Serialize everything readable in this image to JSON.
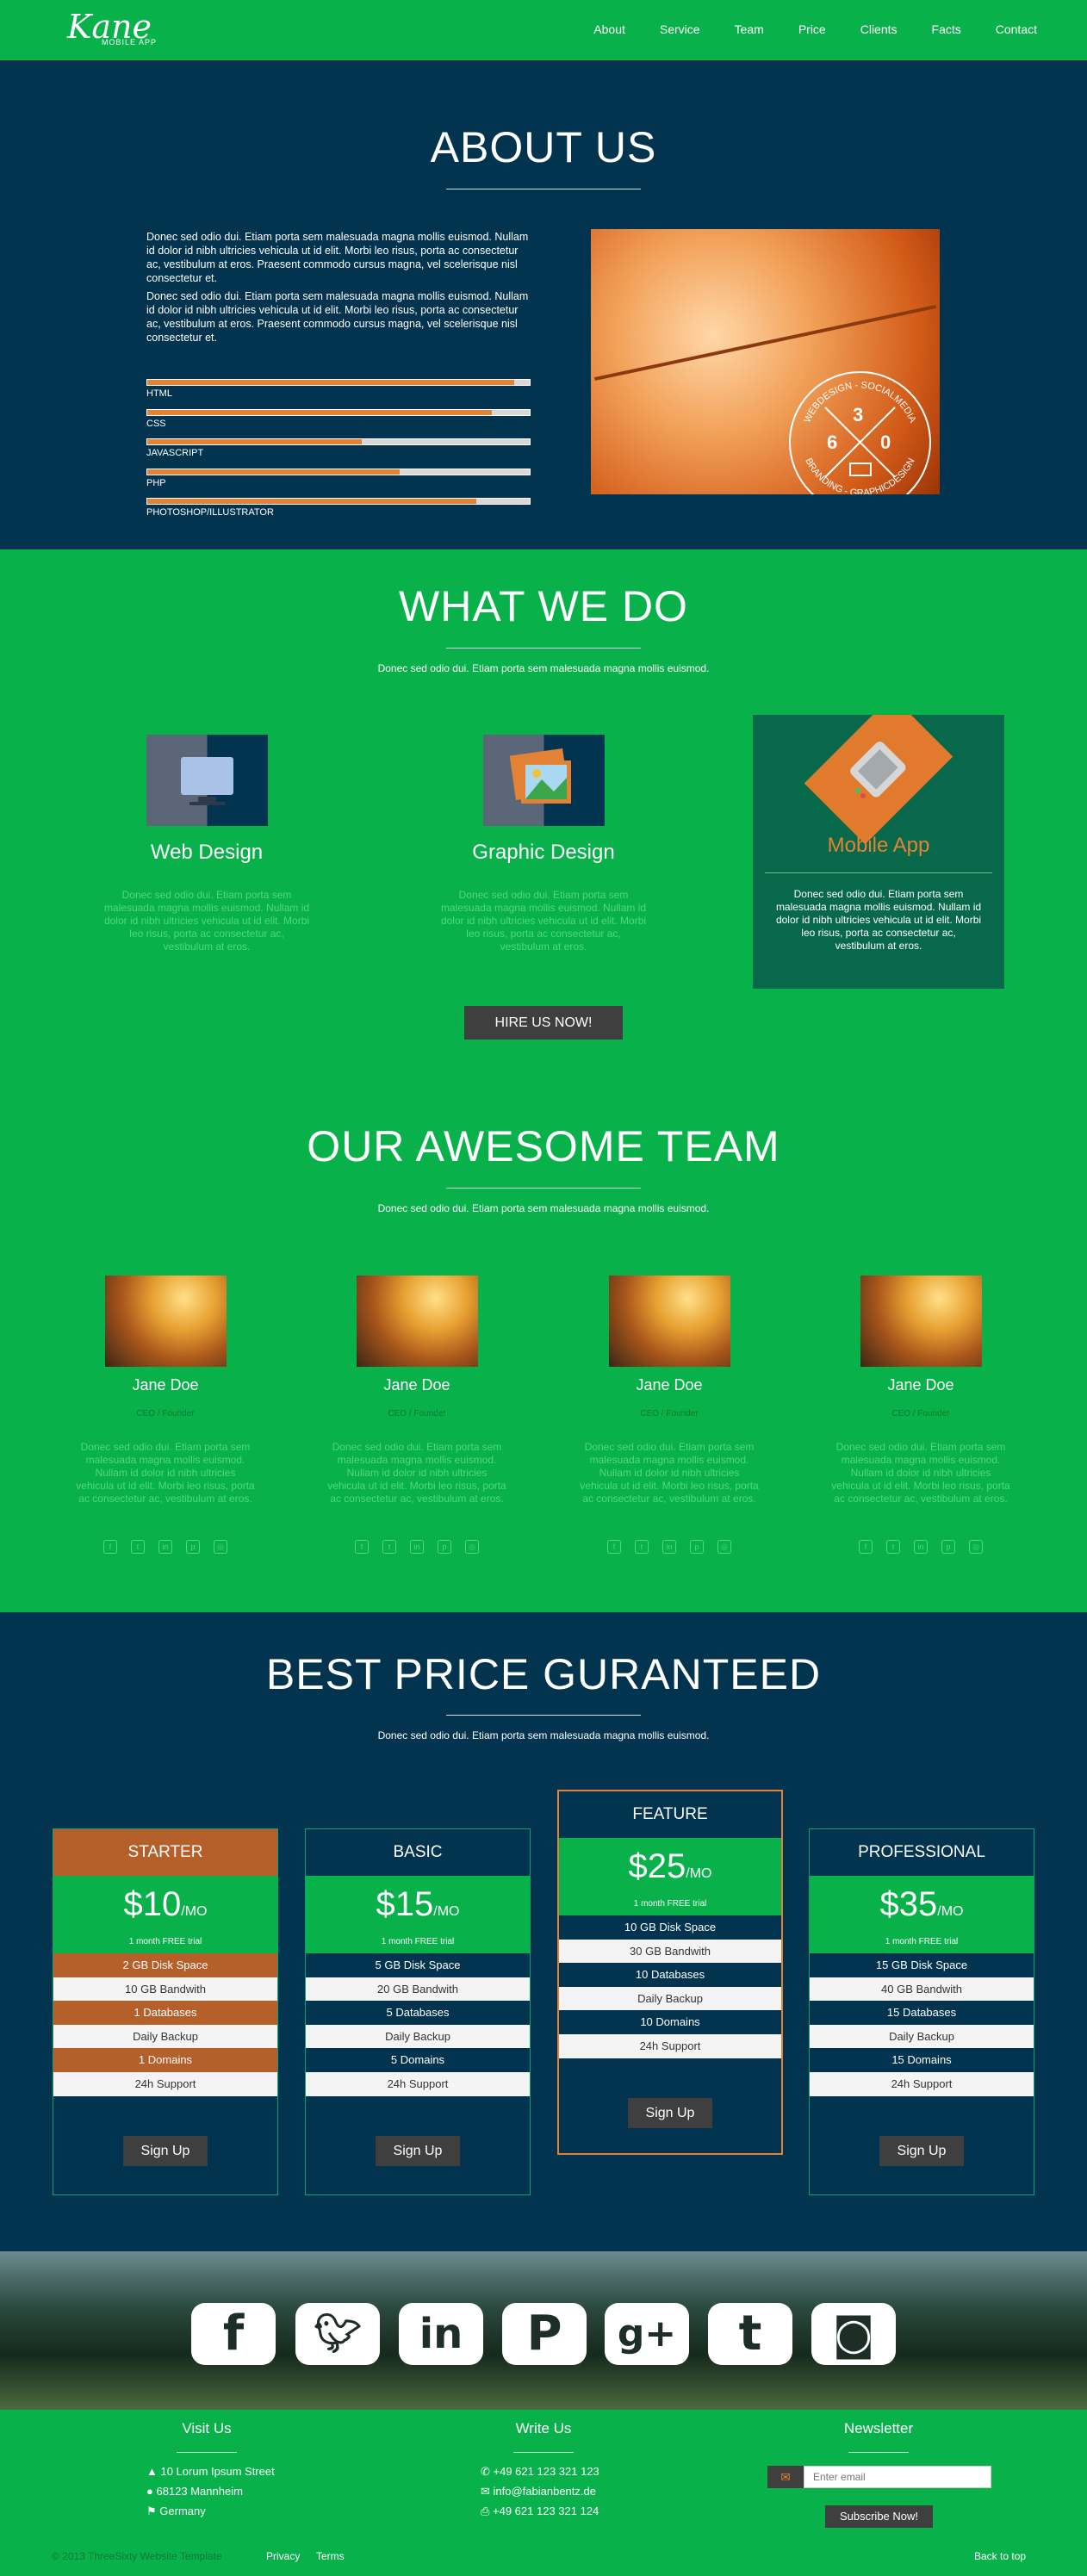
{
  "nav": {
    "logo": "Kane",
    "logo_sub": "MOBILE APP",
    "items": [
      "About",
      "Service",
      "Team",
      "Price",
      "Clients",
      "Facts",
      "Contact"
    ]
  },
  "about": {
    "title": "ABOUT US",
    "paragraphs": [
      "Donec sed odio dui. Etiam porta sem malesuada magna mollis euismod. Nullam id dolor id nibh ultricies vehicula ut id elit. Morbi leo risus, porta ac consectetur ac, vestibulum at eros. Praesent commodo cursus magna, vel scelerisque nisl consectetur et.",
      "Donec sed odio dui. Etiam porta sem malesuada magna mollis euismod. Nullam id dolor id nibh ultricies vehicula ut id elit. Morbi leo risus, porta ac consectetur ac, vestibulum at eros. Praesent commodo cursus magna, vel scelerisque nisl consectetur et."
    ],
    "skills": [
      {
        "label": "HTML",
        "level": 0.96
      },
      {
        "label": "CSS",
        "level": 0.9
      },
      {
        "label": "JAVASCRIPT",
        "level": 0.56
      },
      {
        "label": "PHP",
        "level": 0.66
      },
      {
        "label": "PHOTOSHOP/ILLUSTRATOR",
        "level": 0.86
      }
    ],
    "badge": {
      "arc_top": "WEBDESIGN - SOCIALMEDIA",
      "arc_bottom": "BRANDING - GRAPHICDESIGN",
      "n1": "3",
      "n2": "6",
      "n3": "0"
    }
  },
  "services": {
    "title": "WHAT WE DO",
    "subtitle": "Donec sed odio dui. Etiam porta sem malesuada magna mollis euismod.",
    "items": [
      {
        "title": "Web Design",
        "text": "Donec sed odio dui. Etiam porta sem malesuada magna mollis euismod. Nullam id dolor id nibh ultricies vehicula ut id elit. Morbi leo risus, porta ac consectetur ac, vestibulum at eros."
      },
      {
        "title": "Graphic Design",
        "text": "Donec sed odio dui. Etiam porta sem malesuada magna mollis euismod. Nullam id dolor id nibh ultricies vehicula ut id elit. Morbi leo risus, porta ac consectetur ac, vestibulum at eros."
      },
      {
        "title": "Mobile App",
        "text": "Donec sed odio dui. Etiam porta sem malesuada magna mollis euismod. Nullam id dolor id nibh ultricies vehicula ut id elit. Morbi leo risus, porta ac consectetur ac, vestibulum at eros."
      }
    ],
    "cta": "HIRE US NOW!"
  },
  "team": {
    "title": "OUR AWESOME TEAM",
    "subtitle": "Donec sed odio dui. Etiam porta sem malesuada magna mollis euismod.",
    "members": [
      {
        "name": "Jane Doe",
        "role": "CEO / Founder",
        "text": "Donec sed odio dui. Etiam porta sem malesuada magna mollis euismod. Nullam id dolor id nibh ultricies vehicula ut id elit. Morbi leo risus, porta ac consectetur ac, vestibulum at eros."
      },
      {
        "name": "Jane Doe",
        "role": "CEO / Founder",
        "text": "Donec sed odio dui. Etiam porta sem malesuada magna mollis euismod. Nullam id dolor id nibh ultricies vehicula ut id elit. Morbi leo risus, porta ac consectetur ac, vestibulum at eros."
      },
      {
        "name": "Jane Doe",
        "role": "CEO / Founder",
        "text": "Donec sed odio dui. Etiam porta sem malesuada magna mollis euismod. Nullam id dolor id nibh ultricies vehicula ut id elit. Morbi leo risus, porta ac consectetur ac, vestibulum at eros."
      },
      {
        "name": "Jane Doe",
        "role": "CEO / Founder",
        "text": "Donec sed odio dui. Etiam porta sem malesuada magna mollis euismod. Nullam id dolor id nibh ultricies vehicula ut id elit. Morbi leo risus, porta ac consectetur ac, vestibulum at eros."
      }
    ],
    "social_icons": [
      "facebook-icon",
      "twitter-icon",
      "linkedin-icon",
      "pinterest-icon",
      "instagram-icon"
    ]
  },
  "pricing": {
    "title": "BEST PRICE GURANTEED",
    "subtitle": "Donec sed odio dui. Etiam porta sem malesuada magna mollis euismod.",
    "plans": [
      {
        "name": "STARTER",
        "price": "$10",
        "per": "/MO",
        "note": "1 month FREE trial",
        "features": [
          "2 GB Disk Space",
          "10 GB Bandwith",
          "1 Databases",
          "Daily Backup",
          "1 Domains",
          "24h Support"
        ],
        "button": "Sign Up"
      },
      {
        "name": "BASIC",
        "price": "$15",
        "per": "/MO",
        "note": "1 month FREE trial",
        "features": [
          "5 GB Disk Space",
          "20 GB Bandwith",
          "5 Databases",
          "Daily Backup",
          "5 Domains",
          "24h Support"
        ],
        "button": "Sign Up"
      },
      {
        "name": "FEATURE",
        "price": "$25",
        "per": "/MO",
        "note": "1 month FREE trial",
        "features": [
          "10 GB Disk Space",
          "30 GB Bandwith",
          "10 Databases",
          "Daily Backup",
          "10 Domains",
          "24h Support"
        ],
        "button": "Sign Up"
      },
      {
        "name": "PROFESSIONAL",
        "price": "$35",
        "per": "/MO",
        "note": "1 month FREE trial",
        "features": [
          "15 GB Disk Space",
          "40 GB Bandwith",
          "15 Databases",
          "Daily Backup",
          "15 Domains",
          "24h Support"
        ],
        "button": "Sign Up"
      }
    ]
  },
  "social_banner": [
    "facebook-icon",
    "twitter-icon",
    "linkedin-icon",
    "pinterest-icon",
    "google-plus-icon",
    "tumblr-icon",
    "instagram-icon"
  ],
  "footer": {
    "visit": {
      "title": "Visit Us",
      "lines": [
        "10 Lorum Ipsum Street",
        "68123 Mannheim",
        "Germany"
      ]
    },
    "write": {
      "title": "Write Us",
      "lines": [
        "+49 621 123 321 123",
        "info@fabianbentz.de",
        "+49 621 123 321 124"
      ]
    },
    "newsletter": {
      "title": "Newsletter",
      "placeholder": "Enter email",
      "button": "Subscribe Now!"
    },
    "copyright": "© 2013 ThreeSixty Website Template",
    "links": [
      "Privacy",
      "Terms"
    ],
    "back_to_top": "Back to top"
  },
  "colors": {
    "green": "#08b14a",
    "navy": "#02344f",
    "orange": "#e28235",
    "starter": "#b5602a",
    "dark_button": "#3f3f3f"
  }
}
